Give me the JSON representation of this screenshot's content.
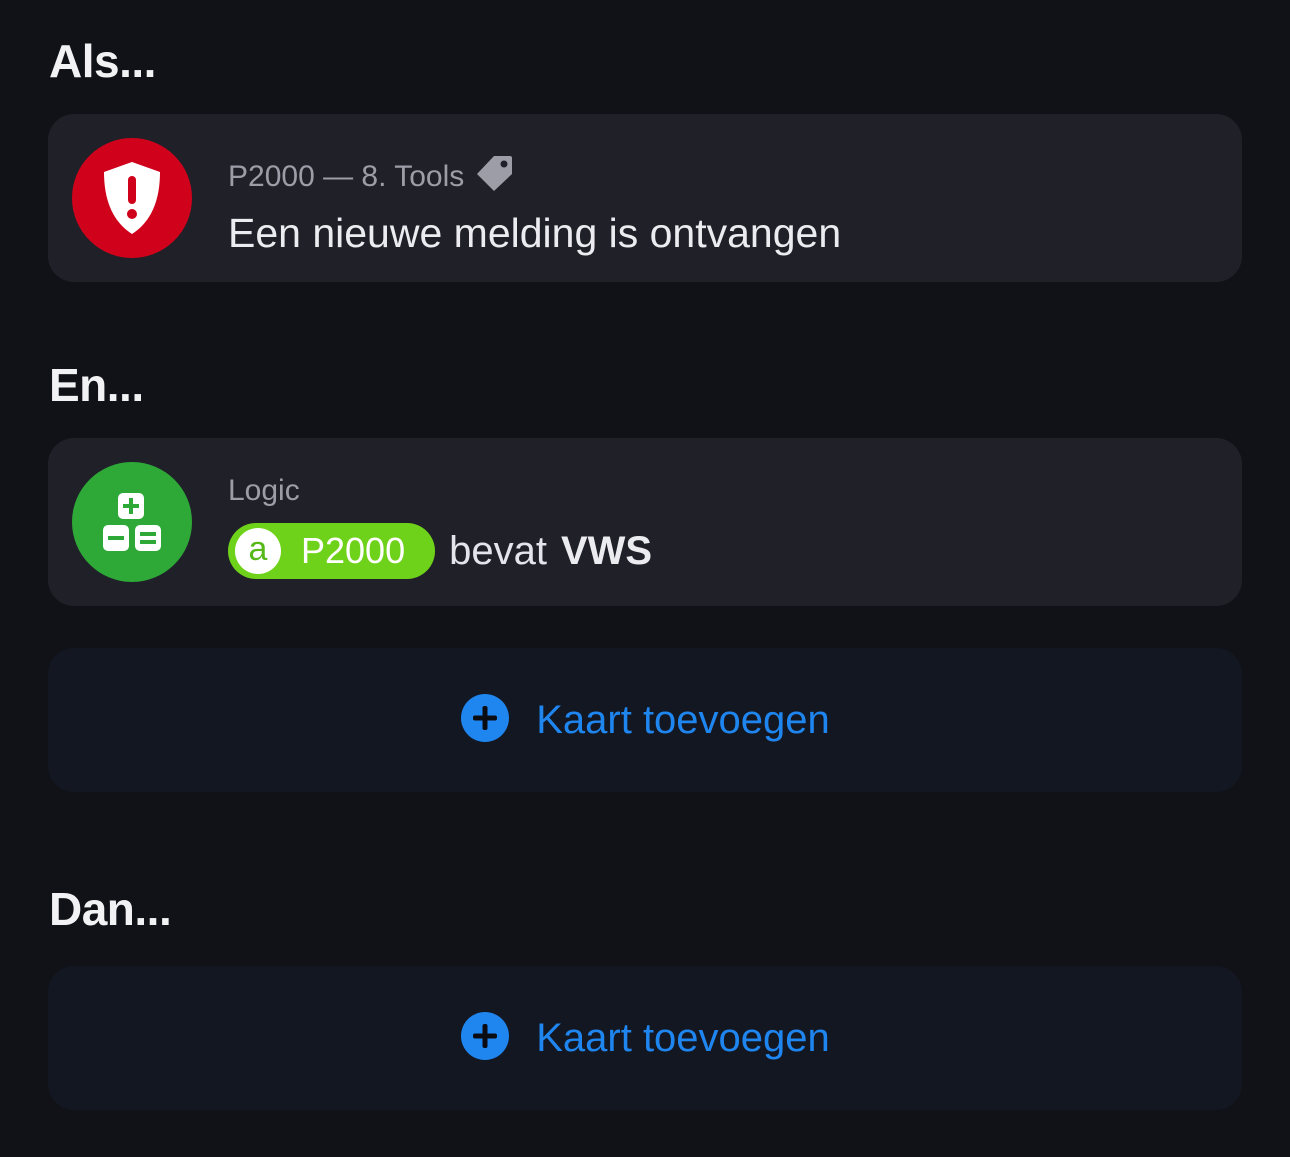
{
  "sections": {
    "als": "Als...",
    "en": "En...",
    "dan": "Dan..."
  },
  "trigger_card": {
    "subtitle": "P2000 — 8. Tools",
    "title": "Een nieuwe melding is ontvangen",
    "icon": "shield-alert-icon",
    "tag_icon": "tag-icon",
    "icon_color": "#d0021b"
  },
  "logic_card": {
    "subtitle": "Logic",
    "token": {
      "badge": "a",
      "label": "P2000",
      "color": "#6fd21a"
    },
    "operator": "bevat",
    "value": "VWS",
    "icon": "calculator-icon",
    "icon_color": "#2ea836"
  },
  "add_card_en": {
    "label": "Kaart toevoegen",
    "icon": "plus-circle-icon"
  },
  "add_card_dan": {
    "label": "Kaart toevoegen",
    "icon": "plus-circle-icon"
  },
  "colors": {
    "background": "#111217",
    "card": "#202029",
    "add_card": "#131722",
    "accent_blue": "#1f86f0"
  }
}
